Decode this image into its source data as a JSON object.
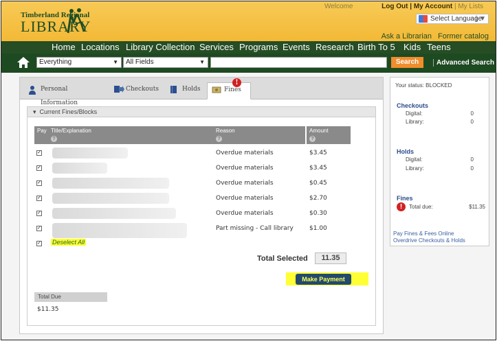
{
  "header": {
    "logo_small": "Timberland Regional",
    "logo_big": "LIBRARY",
    "welcome": "Welcome",
    "logout": "Log Out",
    "my_account": "My Account",
    "my_lists": "My Lists",
    "language": "Select Language",
    "ask_librarian": "Ask a Librarian",
    "former_catalog": "Former catalog"
  },
  "nav": [
    "Home",
    "Locations",
    "Library Collection",
    "Services",
    "Programs",
    "Events",
    "Research",
    "Birth To 5",
    "Kids",
    "Teens"
  ],
  "search": {
    "scope": "Everything",
    "field": "All Fields",
    "query": "",
    "button": "Search",
    "advanced": "Advanced Search"
  },
  "tabs": [
    "Personal Information",
    "Checkouts",
    "Holds",
    "Fines"
  ],
  "fines": {
    "section_title": "Current Fines/Blocks",
    "columns": {
      "pay": "Pay",
      "title": "Title/Explanation",
      "reason": "Reason",
      "amount": "Amount"
    },
    "rows": [
      {
        "reason": "Overdue materials",
        "amount": "$3.45"
      },
      {
        "reason": "Overdue materials",
        "amount": "$3.45"
      },
      {
        "reason": "Overdue materials",
        "amount": "$0.45"
      },
      {
        "reason": "Overdue materials",
        "amount": "$2.70"
      },
      {
        "reason": "Overdue materials",
        "amount": "$0.30"
      },
      {
        "reason": "Part missing - Call library",
        "amount": "$1.00"
      }
    ],
    "deselect_all": "Deselect All",
    "total_selected_label": "Total Selected",
    "total_selected_value": "11.35",
    "make_payment": "Make Payment",
    "total_due_label": "Total Due",
    "total_due_value": "$11.35"
  },
  "sidebar": {
    "status": "Your status: BLOCKED",
    "checkouts_title": "Checkouts",
    "checkouts_digital_label": "Digital:",
    "checkouts_digital": "0",
    "checkouts_library_label": "Library:",
    "checkouts_library": "0",
    "holds_title": "Holds",
    "holds_digital_label": "Digital:",
    "holds_digital": "0",
    "holds_library_label": "Library:",
    "holds_library": "0",
    "fines_title": "Fines",
    "fines_total_label": "Total due:",
    "fines_total": "$11.35",
    "link_pay": "Pay Fines & Fees Online",
    "link_overdrive": "Overdrive Checkouts & Holds"
  },
  "colors": {
    "accent_green": "#264d24",
    "header_gold": "#f3b936",
    "search_orange": "#f08d2c",
    "alert_red": "#d12121",
    "highlight": "#ffff33"
  }
}
